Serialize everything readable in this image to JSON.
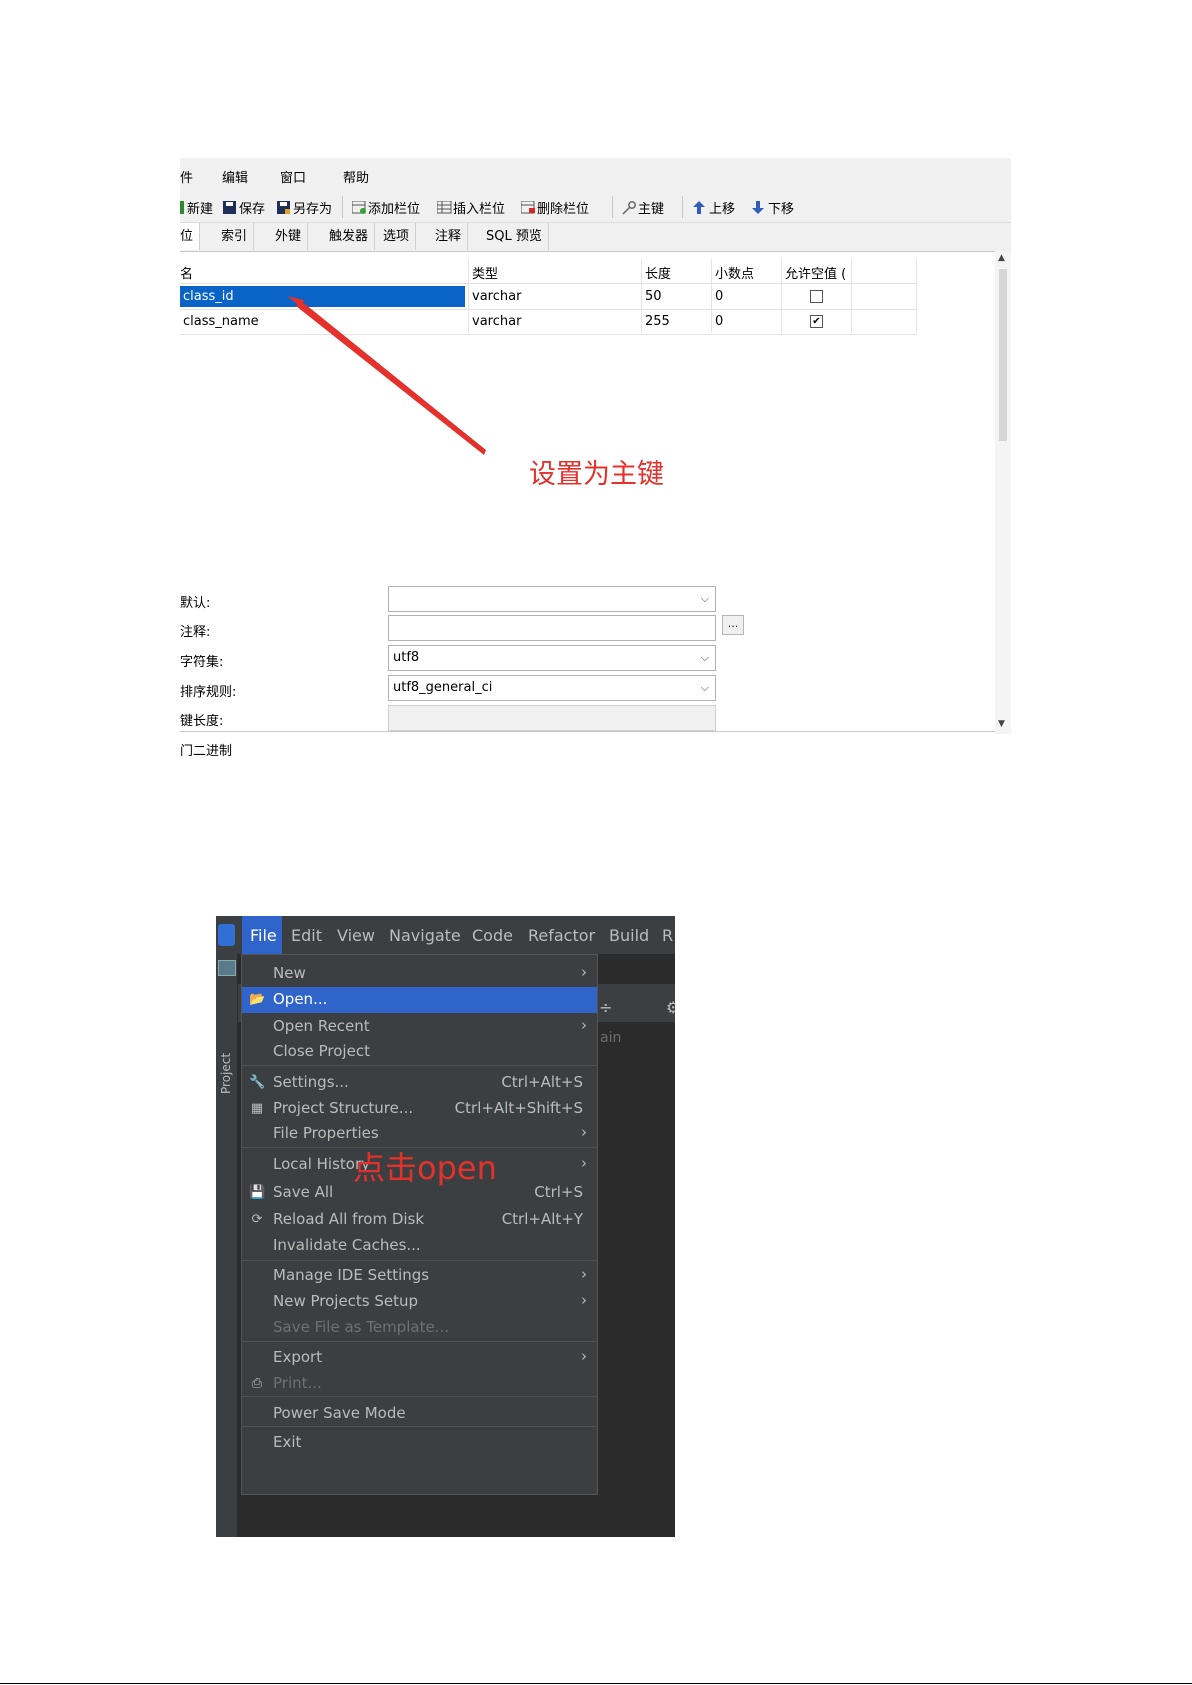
{
  "shot1": {
    "menu": [
      "件",
      "编辑",
      "窗口",
      "帮助"
    ],
    "toolbar": {
      "new": "新建",
      "save": "保存",
      "save_as": "另存为",
      "add_field": "添加栏位",
      "insert_field": "插入栏位",
      "delete_field": "删除栏位",
      "primary_key": "主键",
      "move_up": "上移",
      "move_down": "下移"
    },
    "tabs": [
      "位",
      "索引",
      "外键",
      "触发器",
      "选项",
      "注释",
      "SQL 预览"
    ],
    "columns": {
      "name": "名",
      "type": "类型",
      "length": "长度",
      "decimals": "小数点",
      "allow_null": "允许空值 ("
    },
    "rows": [
      {
        "name": "class_id",
        "type": "varchar",
        "length": "50",
        "decimals": "0",
        "allow_null": false,
        "selected": true
      },
      {
        "name": "class_name",
        "type": "varchar",
        "length": "255",
        "decimals": "0",
        "allow_null": true,
        "selected": false
      }
    ],
    "props": {
      "default_label": "默认:",
      "comment_label": "注释:",
      "charset_label": "字符集:",
      "collation_label": "排序规则:",
      "keylen_label": "键长度:",
      "binary_label": "门二进制",
      "default_value": "",
      "comment_value": "",
      "charset_value": "utf8",
      "collation_value": "utf8_general_ci",
      "ellipsis": "..."
    },
    "annotation": "设置为主键",
    "annotation_color": "#e4312b",
    "selection_color": "#0a64c8"
  },
  "shot2": {
    "menubar": [
      "File",
      "Edit",
      "View",
      "Navigate",
      "Code",
      "Refactor",
      "Build",
      "R"
    ],
    "side_label": "Project",
    "bg_text": "ain",
    "items": [
      {
        "label": "New",
        "submenu": true
      },
      {
        "label": "Open...",
        "icon": "folder-open-icon",
        "highlighted": true
      },
      {
        "label": "Open Recent",
        "submenu": true
      },
      {
        "label": "Close Project"
      },
      {
        "label": "Settings...",
        "icon": "wrench-icon",
        "shortcut": "Ctrl+Alt+S"
      },
      {
        "label": "Project Structure...",
        "icon": "project-structure-icon",
        "shortcut": "Ctrl+Alt+Shift+S"
      },
      {
        "label": "File Properties",
        "submenu": true
      },
      {
        "label": "Local History",
        "submenu": true
      },
      {
        "label": "Save All",
        "icon": "floppy-disk-icon",
        "shortcut": "Ctrl+S"
      },
      {
        "label": "Reload All from Disk",
        "icon": "reload-icon",
        "shortcut": "Ctrl+Alt+Y"
      },
      {
        "label": "Invalidate Caches..."
      },
      {
        "label": "Manage IDE Settings",
        "submenu": true
      },
      {
        "label": "New Projects Setup",
        "submenu": true
      },
      {
        "label": "Save File as Template...",
        "disabled": true
      },
      {
        "label": "Export",
        "submenu": true
      },
      {
        "label": "Print...",
        "icon": "printer-icon",
        "disabled": true
      },
      {
        "label": "Power Save Mode"
      },
      {
        "label": "Exit"
      }
    ],
    "annotation": "点击open",
    "annotation_color": "#e4312b",
    "highlight_color": "#2f65ca"
  }
}
